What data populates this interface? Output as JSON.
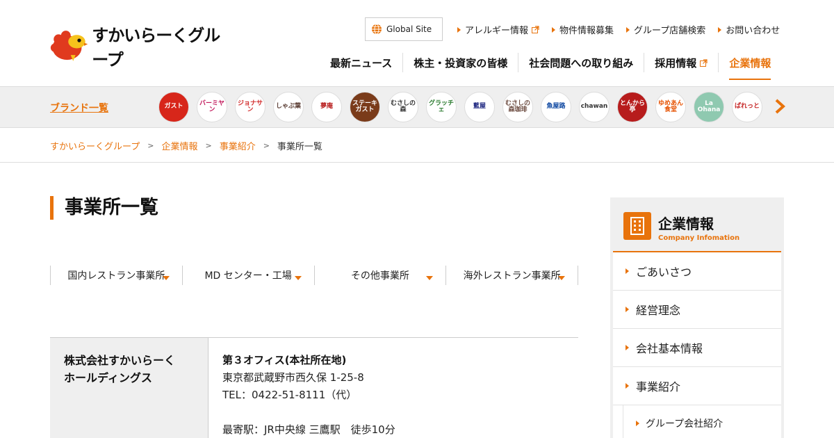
{
  "header": {
    "logo_text": "すかいらーくグループ",
    "global_site": "Global Site",
    "util_links": [
      "アレルギー情報",
      "物件情報募集",
      "グループ店舗検索",
      "お問い合わせ"
    ],
    "nav": [
      "最新ニュース",
      "株主・投資家の皆様",
      "社会問題への取り組み",
      "採用情報",
      "企業情報"
    ]
  },
  "brand_bar": {
    "title": "ブランド一覧",
    "brands": [
      "ガスト",
      "バーミヤン",
      "ジョナサン",
      "しゃぶ葉",
      "夢庵",
      "ステーキガスト",
      "むさしの森",
      "グラッチェ",
      "藍屋",
      "むさしの森珈琲",
      "魚屋路",
      "chawan",
      "とんから亭",
      "ゆめあん食堂",
      "La Ohana",
      "ぱれっと"
    ]
  },
  "breadcrumb": [
    "すかいらーくグループ",
    "企業情報",
    "事業紹介",
    "事業所一覧"
  ],
  "main": {
    "title": "事業所一覧",
    "tabs": [
      "国内レストラン事業所",
      "MD センター・工場",
      "その他事業所",
      "海外レストラン事業所"
    ],
    "office": {
      "company_line1": "株式会社すかいらーく",
      "company_line2": "ホールディングス",
      "name": "第３オフィス(本社所在地)",
      "address": "東京都武蔵野市西久保 1-25-8",
      "tel": "TEL：0422-51-8111（代）",
      "station": "最寄駅：JR中央線 三鷹駅　徒歩10分"
    }
  },
  "sidebar": {
    "title": "企業情報",
    "subtitle": "Company Infomation",
    "items": [
      "ごあいさつ",
      "経営理念",
      "会社基本情報",
      "事業紹介"
    ],
    "sub_items": [
      "グループ会社紹介"
    ]
  },
  "colors": {
    "accent": "#e8730c",
    "bar_bg": "#efefef"
  }
}
